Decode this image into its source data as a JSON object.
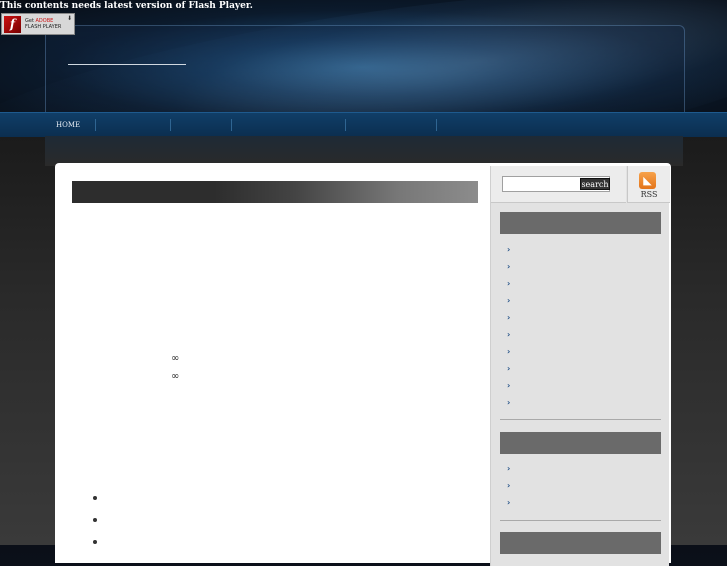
{
  "flash": {
    "message": "This contents needs latest version of Flash Player.",
    "badge_get": "Get",
    "badge_adobe": "ADOBE",
    "badge_product": "FLASH PLAYER",
    "badge_icon": "f"
  },
  "nav": {
    "items": [
      "HOME",
      "",
      "",
      "",
      "",
      ""
    ]
  },
  "search": {
    "value": "",
    "button_label": "search"
  },
  "rss": {
    "label": "RSS",
    "icon": "rss-icon"
  },
  "main": {
    "infinity_symbols": [
      "∞",
      "∞"
    ]
  },
  "colors": {
    "nav_bg": "#0b2e50",
    "sidebar_head": "#6a6a6a",
    "link": "#1f4f86",
    "rss_orange": "#e3741a"
  }
}
